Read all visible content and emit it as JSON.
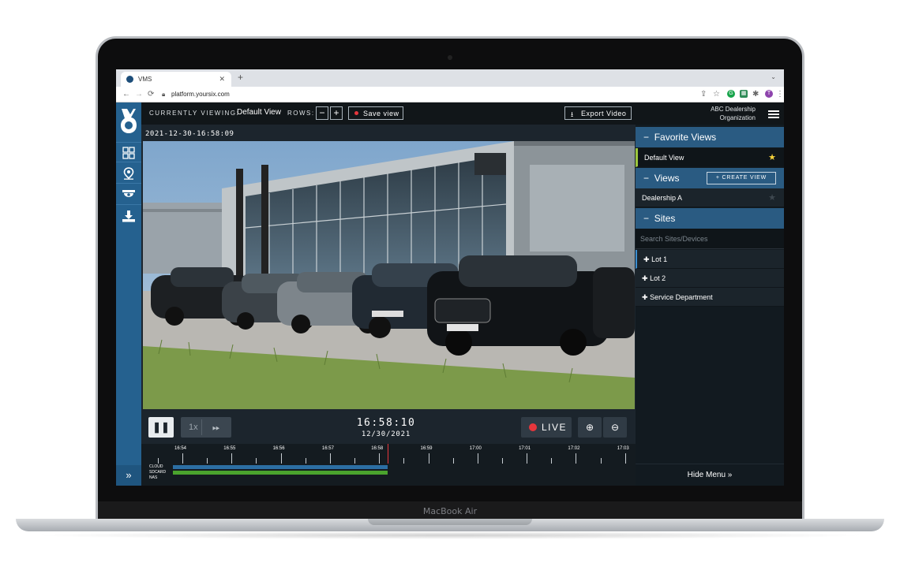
{
  "laptop": {
    "brand": "MacBook Air"
  },
  "browser": {
    "tab_title": "VMS",
    "new_tab_symbol": "+",
    "url": "platform.yoursix.com",
    "profile_initial": "T"
  },
  "header": {
    "currently_viewing_label": "CURRENTLY VIEWING:",
    "current_view": "Default View",
    "rows_label": "ROWS:",
    "minus": "−",
    "plus": "+",
    "save_view": "Save view",
    "export_video": "Export Video"
  },
  "org": {
    "line1": "ABC Dealership",
    "line2": "Organization"
  },
  "video": {
    "timestamp": "2021-12-30-16:58:09"
  },
  "controls": {
    "speed": "1x",
    "time": "16:58:10",
    "date": "12/30/2021",
    "live": "LIVE"
  },
  "timeline": {
    "ticks": [
      "16:54",
      "16:55",
      "16:56",
      "16:57",
      "16:58",
      "16:59",
      "17:00",
      "17:01",
      "17:02",
      "17:03"
    ],
    "storage": [
      "CLOUD",
      "SDCARD",
      "NAS"
    ],
    "colors": {
      "cloud": "#2c6ea3",
      "sdcard": "#4aa32d",
      "cursor": "#e6363c"
    }
  },
  "sidebar": {
    "favorite_views_title": "Favorite Views",
    "favorite_item": "Default View",
    "views_title": "Views",
    "create_view": "+ CREATE VIEW",
    "views_item": "Dealership A",
    "sites_title": "Sites",
    "search_placeholder": "Search Sites/Devices",
    "sites": [
      "Lot 1",
      "Lot 2",
      "Service Department"
    ],
    "hide_menu": "Hide Menu"
  },
  "icons": [
    "grid-icon",
    "map-pin-icon",
    "camera-icon",
    "download-icon",
    "expand-icon",
    "star-icon",
    "menu-icon",
    "pause-icon",
    "fast-forward-icon",
    "zoom-in-icon",
    "zoom-out-icon"
  ],
  "colors": {
    "accent": "#25618f",
    "panel_header": "#2a5b82",
    "favorite_marker": "#9bc53d",
    "star": "#f6d23a",
    "live_dot": "#e6363c"
  }
}
